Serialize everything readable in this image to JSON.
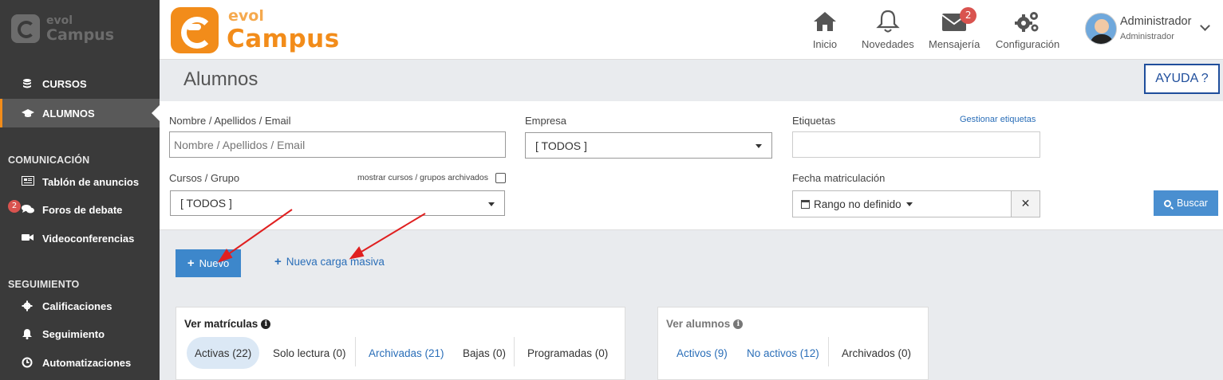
{
  "sidebar": {
    "logo_top": "evol",
    "logo_bottom": "Campus",
    "items": [
      {
        "label": "CURSOS"
      },
      {
        "label": "ALUMNOS"
      }
    ],
    "section_comunicacion": "COMUNICACIÓN",
    "comunicacion_items": [
      {
        "label": "Tablón de anuncios"
      },
      {
        "label": "Foros de debate",
        "badge": "2"
      },
      {
        "label": "Videoconferencias"
      }
    ],
    "section_seguimiento": "SEGUIMIENTO",
    "seguimiento_items": [
      {
        "label": "Calificaciones"
      },
      {
        "label": "Seguimiento"
      },
      {
        "label": "Automatizaciones"
      }
    ]
  },
  "header": {
    "brand_top": "evol",
    "brand_bottom": "Campus",
    "nav": [
      {
        "label": "Inicio",
        "icon": "home-icon"
      },
      {
        "label": "Novedades",
        "icon": "bell-icon"
      },
      {
        "label": "Mensajería",
        "icon": "envelope-icon",
        "badge": "2"
      },
      {
        "label": "Configuración",
        "icon": "gears-icon"
      }
    ],
    "user_name": "Administrador",
    "user_role": "Administrador"
  },
  "page": {
    "title": "Alumnos",
    "help_label": "AYUDA ?"
  },
  "filters": {
    "name_label": "Nombre / Apellidos / Email",
    "name_placeholder": "Nombre / Apellidos / Email",
    "company_label": "Empresa",
    "company_value": "[ TODOS ]",
    "tags_label": "Etiquetas",
    "manage_tags_link": "Gestionar etiquetas",
    "courses_label": "Cursos / Grupo",
    "show_archived_label": "mostrar cursos / grupos archivados",
    "courses_value": "[ TODOS ]",
    "date_label": "Fecha matriculación",
    "date_value": "Rango no definido",
    "search_label": "Buscar"
  },
  "actions": {
    "new_label": "Nuevo",
    "bulk_label": "Nueva carga masiva"
  },
  "enrollments": {
    "title": "Ver matrículas",
    "tabs": [
      {
        "label": "Activas (22)"
      },
      {
        "label": "Solo lectura (0)"
      },
      {
        "label": "Archivadas (21)"
      },
      {
        "label": "Bajas (0)"
      },
      {
        "label": "Programadas (0)"
      }
    ]
  },
  "students": {
    "title": "Ver alumnos",
    "tabs": [
      {
        "label": "Activos (9)"
      },
      {
        "label": "No activos (12)"
      },
      {
        "label": "Archivados (0)"
      }
    ]
  },
  "colors": {
    "sidebar_bg": "#3a3a3a",
    "brand_orange": "#f28c1a",
    "primary_blue": "#3d87cb",
    "link_blue": "#2a6eb8",
    "badge_red": "#d9534f",
    "annotation_arrow": "#e02020"
  }
}
